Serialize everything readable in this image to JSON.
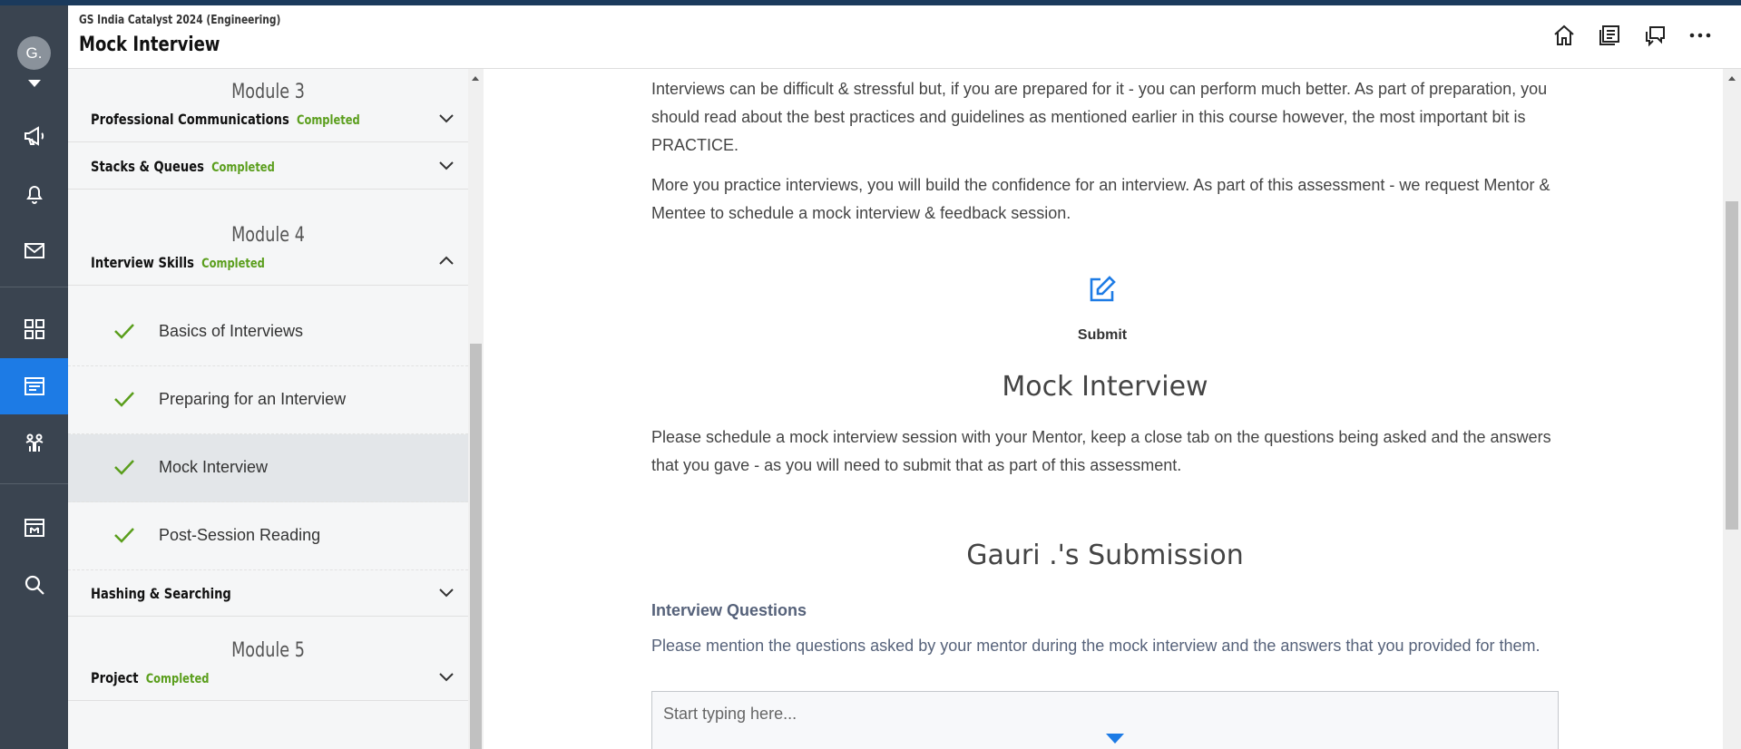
{
  "user": {
    "avatar_initial": "G."
  },
  "header": {
    "course": "GS India Catalyst 2024 (Engineering)",
    "title": "Mock Interview",
    "icons": [
      "home-icon",
      "library-icon",
      "chat-icon",
      "more-icon"
    ]
  },
  "rail": {
    "items": [
      "megaphone-icon",
      "bell-icon",
      "mail-icon",
      "grid-icon",
      "course-icon",
      "community-icon",
      "store-icon",
      "search-icon"
    ],
    "active": "course-icon"
  },
  "sidebar": {
    "modules": [
      {
        "title": "Module 3",
        "sections": [
          {
            "title": "Professional Communications",
            "status": "Completed",
            "expanded": false
          },
          {
            "title": "Stacks & Queues",
            "status": "Completed",
            "expanded": false
          }
        ]
      },
      {
        "title": "Module 4",
        "sections": [
          {
            "title": "Interview Skills",
            "status": "Completed",
            "expanded": true,
            "lessons": [
              {
                "title": "Basics of Interviews",
                "done": true
              },
              {
                "title": "Preparing for an Interview",
                "done": true
              },
              {
                "title": "Mock Interview",
                "done": true,
                "active": true
              },
              {
                "title": "Post-Session Reading",
                "done": true
              }
            ]
          },
          {
            "title": "Hashing & Searching",
            "status": "",
            "expanded": false
          }
        ]
      },
      {
        "title": "Module 5",
        "sections": [
          {
            "title": "Project",
            "status": "Completed",
            "expanded": false
          }
        ]
      }
    ]
  },
  "main": {
    "intro_1": "Interviews can be difficult & stressful but, if you are prepared for it - you can perform much better. As part of preparation, you should read about the best practices and guidelines as mentioned earlier in this course however, the most important bit is PRACTICE.",
    "intro_2": "More you practice interviews, you will build the confidence for an interview. As part of this assessment - we request Mentor & Mentee to schedule a mock interview & feedback session.",
    "submit_label": "Submit",
    "heading": "Mock Interview",
    "instructions": "Please schedule a mock interview session with your Mentor, keep a close tab on the questions being asked and the answers that you gave - as you will need to submit that as part of this assessment.",
    "submission_heading": "Gauri .'s Submission",
    "question_label": "Interview Questions",
    "question_help": "Please mention the questions asked by your mentor during the mock interview and the answers that you provided for them.",
    "editor_placeholder": "Start typing here..."
  },
  "colors": {
    "accent": "#1d7be5",
    "rail": "#3a4450",
    "completed": "#5a9e1c"
  }
}
